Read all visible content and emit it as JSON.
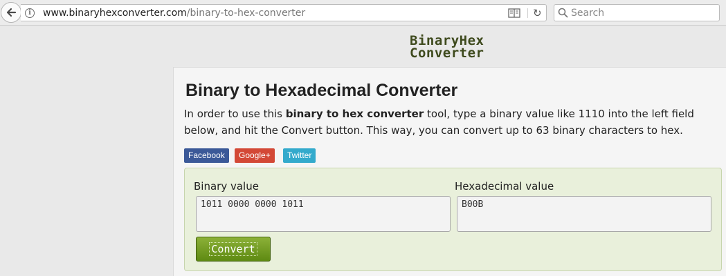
{
  "browser": {
    "url_domain": "www.binaryhexconverter.com",
    "url_path": "/binary-to-hex-converter",
    "search_placeholder": "Search"
  },
  "header": {
    "logo_line1": "BinaryHex",
    "logo_line2": "Converter"
  },
  "main": {
    "title": "Binary to Hexadecimal Converter",
    "intro_part1": "In order to use this ",
    "intro_bold": "binary to hex converter",
    "intro_part2": " tool, type a binary value like 1110 into the left field below, and hit the Convert button. This way, you can convert up to 63 binary characters to hex."
  },
  "social": {
    "facebook": "Facebook",
    "google": "Google+",
    "twitter": "Twitter"
  },
  "converter": {
    "binary_label": "Binary value",
    "hex_label": "Hexadecimal value",
    "binary_value": "1011 0000 0000 1011",
    "hex_value": "B00B",
    "convert_label": "Convert"
  },
  "colors": {
    "panel_bg": "#e9f0db",
    "convert_button": "#6e9a1f",
    "facebook": "#3b5998",
    "google": "#d34836",
    "twitter": "#33aacc"
  }
}
